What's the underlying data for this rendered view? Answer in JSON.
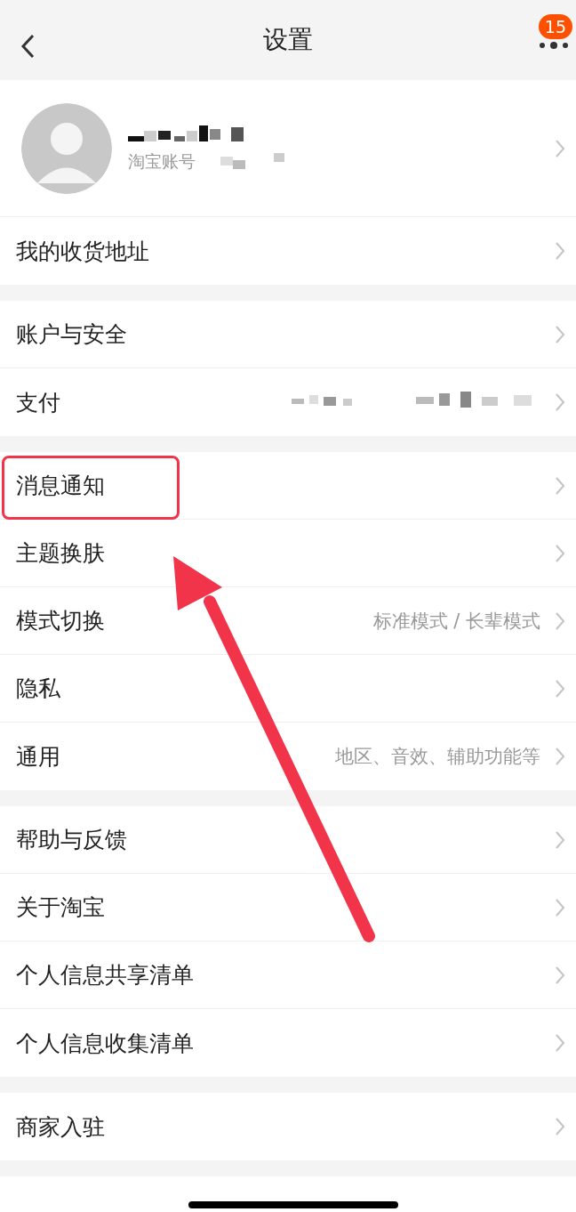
{
  "header": {
    "title": "设置",
    "badge": "15"
  },
  "profile": {
    "account_label": "淘宝账号"
  },
  "groups": [
    {
      "rows": [
        {
          "kind": "profile"
        },
        {
          "kind": "plain",
          "label": "我的收货地址",
          "highlighted": false
        }
      ]
    },
    {
      "rows": [
        {
          "kind": "plain",
          "label": "账户与安全",
          "highlighted": false
        },
        {
          "kind": "masked",
          "label": "支付",
          "highlighted": false
        }
      ]
    },
    {
      "rows": [
        {
          "kind": "plain",
          "label": "消息通知",
          "highlighted": true
        },
        {
          "kind": "plain",
          "label": "主题换肤",
          "highlighted": false
        },
        {
          "kind": "value",
          "label": "模式切换",
          "value": "标准模式 / 长辈模式",
          "highlighted": false
        },
        {
          "kind": "plain",
          "label": "隐私",
          "highlighted": false
        },
        {
          "kind": "value",
          "label": "通用",
          "value": "地区、音效、辅助功能等",
          "highlighted": false
        }
      ]
    },
    {
      "rows": [
        {
          "kind": "plain",
          "label": "帮助与反馈",
          "highlighted": false
        },
        {
          "kind": "plain",
          "label": "关于淘宝",
          "highlighted": false
        },
        {
          "kind": "plain",
          "label": "个人信息共享清单",
          "highlighted": false
        },
        {
          "kind": "plain",
          "label": "个人信息收集清单",
          "highlighted": false
        }
      ]
    },
    {
      "rows": [
        {
          "kind": "plain",
          "label": "商家入驻",
          "highlighted": false
        }
      ]
    }
  ]
}
